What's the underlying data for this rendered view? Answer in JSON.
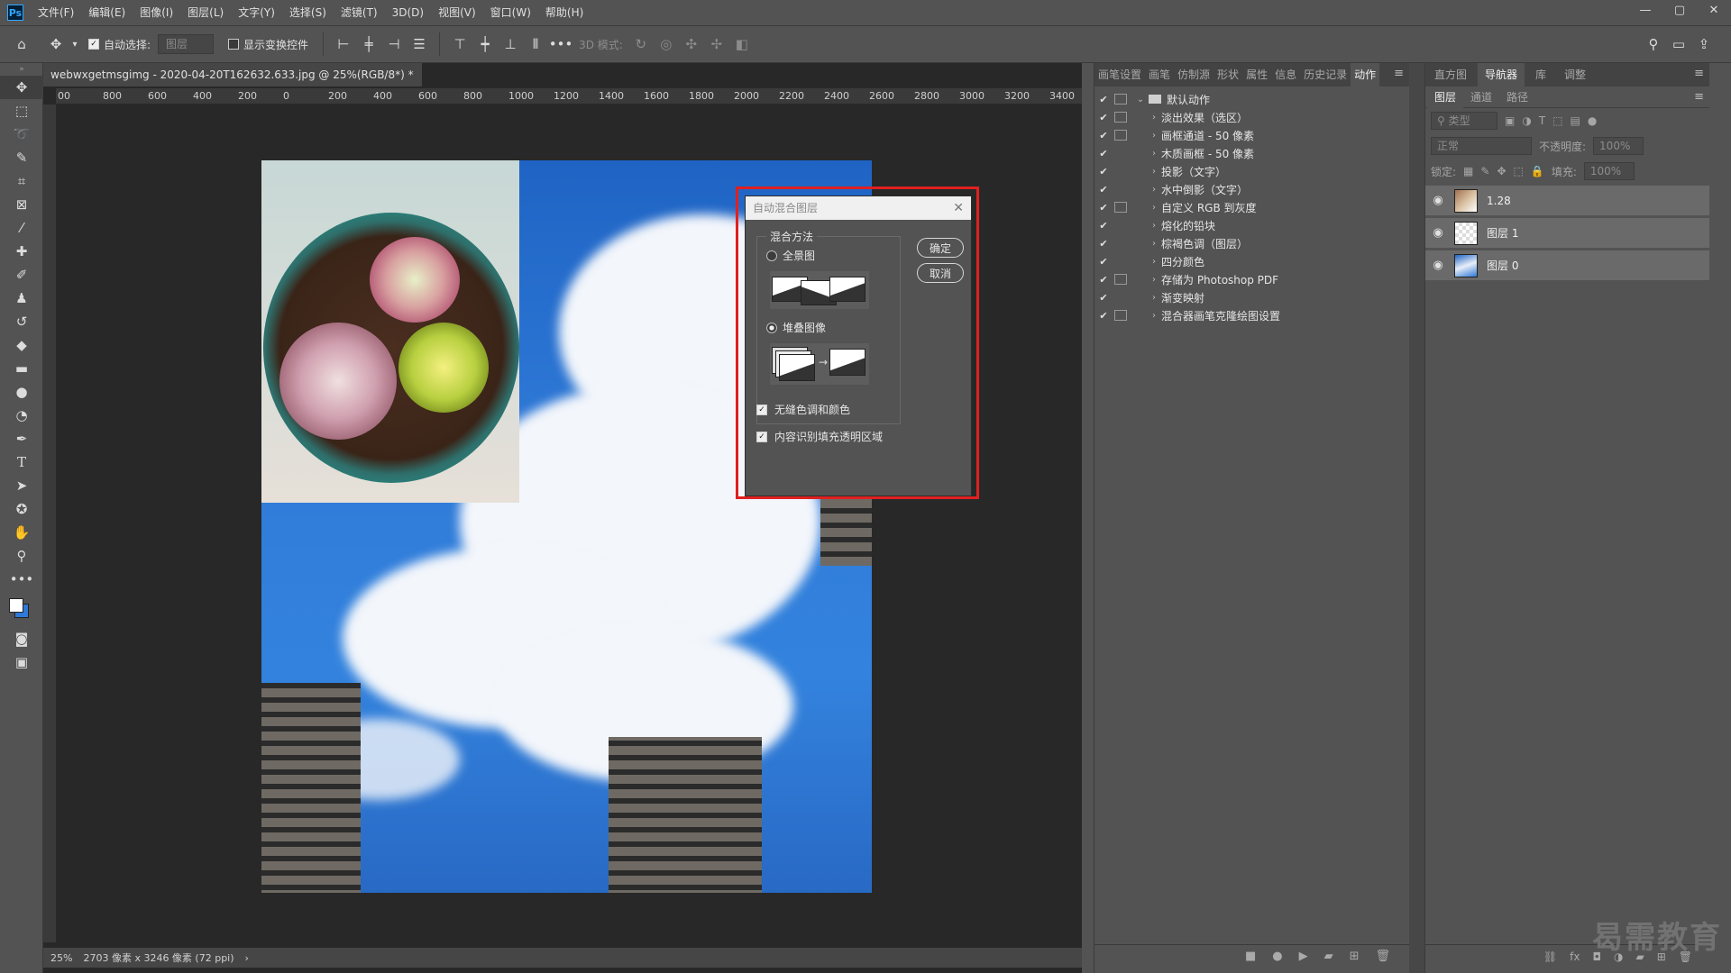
{
  "app": {
    "logo_text": "Ps"
  },
  "menu": [
    "文件(F)",
    "编辑(E)",
    "图像(I)",
    "图层(L)",
    "文字(Y)",
    "选择(S)",
    "滤镜(T)",
    "3D(D)",
    "视图(V)",
    "窗口(W)",
    "帮助(H)"
  ],
  "options": {
    "auto_select_label": "自动选择:",
    "auto_select_target": "图层",
    "show_transform_label": "显示变换控件",
    "mode_3d_label": "3D 模式:"
  },
  "document": {
    "tab_title": "webwxgetmsgimg - 2020-04-20T162632.633.jpg @ 25%(RGB/8*) *",
    "ruler_ticks": [
      "00",
      "800",
      "600",
      "400",
      "200",
      "0",
      "200",
      "400",
      "600",
      "800",
      "1000",
      "1200",
      "1400",
      "1600",
      "1800",
      "2000",
      "2200",
      "2400",
      "2600",
      "2800",
      "3000",
      "3200",
      "3400"
    ],
    "zoom": "25%",
    "status": "2703 像素 x 3246 像素 (72 ppi)"
  },
  "dialog": {
    "title": "自动混合图层",
    "group_label": "混合方法",
    "option_panorama": "全景图",
    "option_stack": "堆叠图像",
    "selected_option": "堆叠图像",
    "ok_label": "确定",
    "cancel_label": "取消",
    "check_seamless": "无缝色调和颜色",
    "check_content_aware": "内容识别填充透明区域"
  },
  "actions_panel": {
    "tabs": [
      "画笔设置",
      "画笔",
      "仿制源",
      "形状",
      "属性",
      "信息",
      "历史记录",
      "动作"
    ],
    "active_tab": "动作",
    "set_name": "默认动作",
    "items": [
      {
        "name": "淡出效果（选区）",
        "dialog": true
      },
      {
        "name": "画框通道 - 50 像素",
        "dialog": true
      },
      {
        "name": "木质画框 - 50 像素",
        "dialog": false
      },
      {
        "name": "投影（文字）",
        "dialog": false
      },
      {
        "name": "水中倒影（文字）",
        "dialog": false
      },
      {
        "name": "自定义 RGB 到灰度",
        "dialog": true
      },
      {
        "name": "熔化的铅块",
        "dialog": false
      },
      {
        "name": "棕褐色调（图层）",
        "dialog": false
      },
      {
        "name": "四分颜色",
        "dialog": false
      },
      {
        "name": "存储为 Photoshop PDF",
        "dialog": true
      },
      {
        "name": "渐变映射",
        "dialog": false
      },
      {
        "name": "混合器画笔克隆绘图设置",
        "dialog": true
      }
    ]
  },
  "right_panel": {
    "top_tabs": [
      "直方图",
      "导航器",
      "库",
      "调整"
    ],
    "active_top_tab": "导航器",
    "sub_tabs": [
      "图层",
      "通道",
      "路径"
    ],
    "active_sub_tab": "图层",
    "filter_placeholder": "类型",
    "blend_mode": "正常",
    "opacity_label": "不透明度:",
    "opacity_value": "100%",
    "lock_label": "锁定:",
    "fill_label": "填充:",
    "fill_value": "100%",
    "layers": [
      {
        "name": "1.28",
        "thumb": "photo"
      },
      {
        "name": "图层 1",
        "thumb": "checker"
      },
      {
        "name": "图层 0",
        "thumb": "sky"
      }
    ]
  },
  "watermark": "曷需教育"
}
